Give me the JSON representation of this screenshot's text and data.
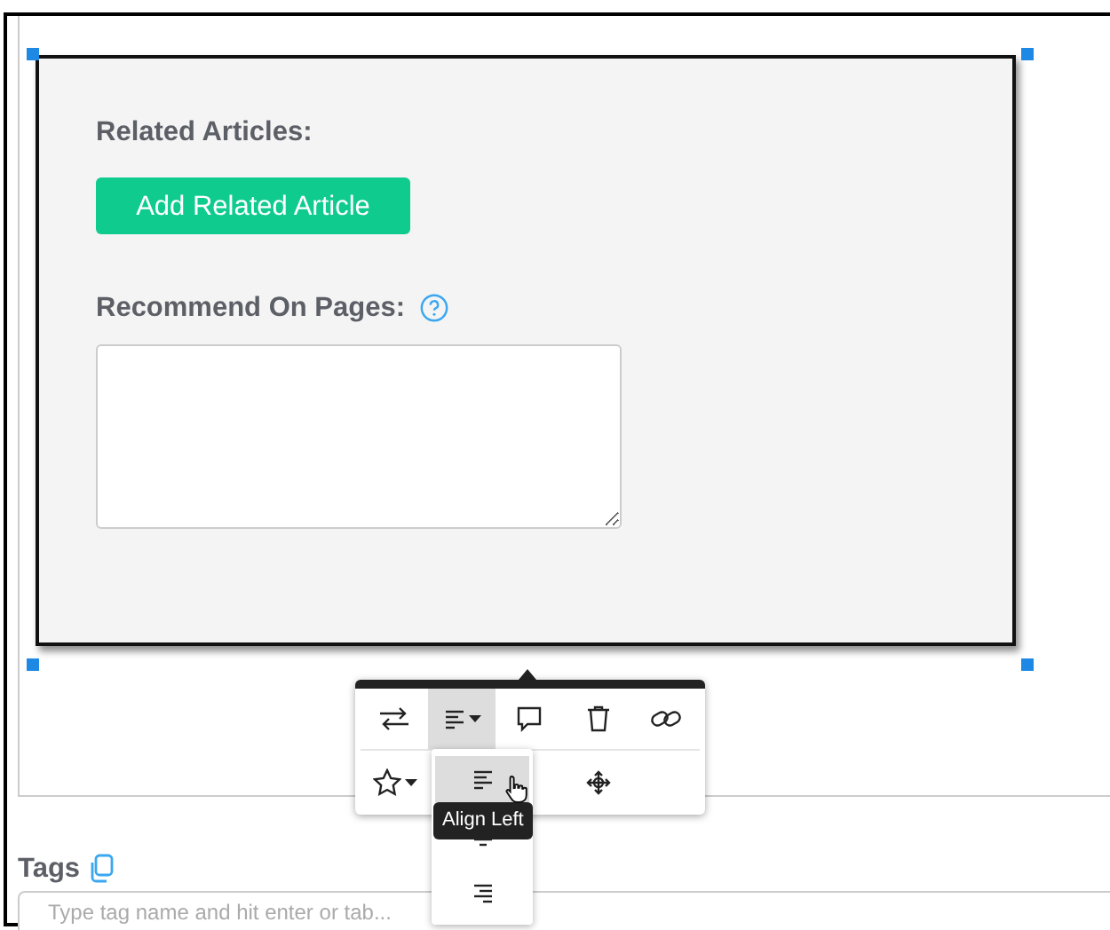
{
  "block": {
    "heading": "Related Articles:",
    "add_button": "Add Related Article",
    "recommend_label": "Recommend On Pages:"
  },
  "toolbar": {
    "tools": [
      {
        "kind": "swap",
        "selected": false
      },
      {
        "kind": "align",
        "selected": true
      },
      {
        "kind": "comment",
        "selected": false
      },
      {
        "kind": "delete",
        "selected": false
      },
      {
        "kind": "link",
        "selected": false
      },
      {
        "kind": "star",
        "selected": false
      },
      {
        "kind": "move",
        "selected": false
      }
    ]
  },
  "align_menu": {
    "options": [
      {
        "kind": "left",
        "selected": true
      },
      {
        "kind": "center",
        "selected": false
      },
      {
        "kind": "right",
        "selected": false
      }
    ],
    "tooltip": "Align Left"
  },
  "tags": {
    "label": "Tags",
    "placeholder": "Type tag name and hit enter or tab..."
  }
}
